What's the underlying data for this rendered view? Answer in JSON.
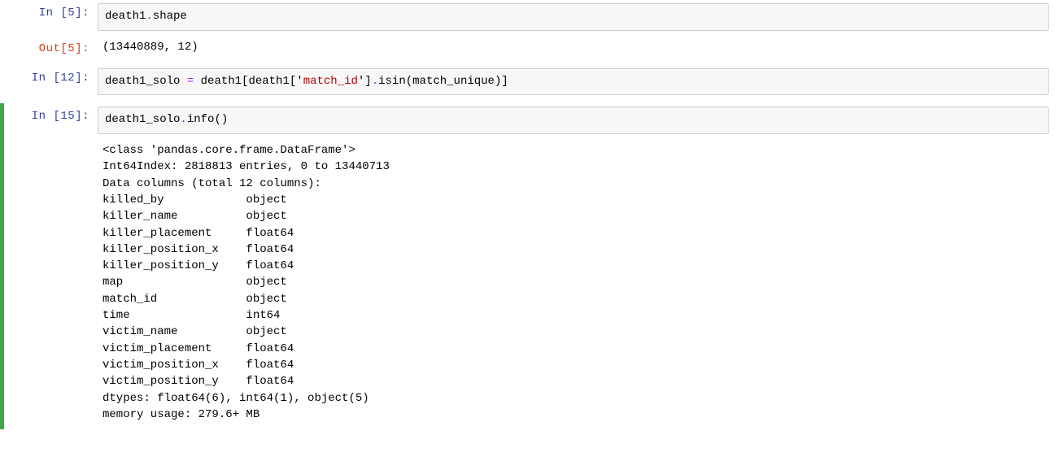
{
  "cells": [
    {
      "execution_count": 5,
      "prompt_in": "In  [5]:",
      "code_tokens": [
        {
          "t": "var",
          "v": "death1"
        },
        {
          "t": "op",
          "v": "."
        },
        {
          "t": "var",
          "v": "shape"
        }
      ],
      "prompt_out": "Out[5]:",
      "output": "(13440889, 12)"
    },
    {
      "execution_count": 12,
      "prompt_in": "In [12]:",
      "code_tokens": [
        {
          "t": "var",
          "v": "death1_solo "
        },
        {
          "t": "op",
          "v": "="
        },
        {
          "t": "var",
          "v": " death1"
        },
        {
          "t": "par",
          "v": "["
        },
        {
          "t": "var",
          "v": "death1"
        },
        {
          "t": "par",
          "v": "['"
        },
        {
          "t": "str",
          "v": "match_id"
        },
        {
          "t": "par",
          "v": "']"
        },
        {
          "t": "op",
          "v": "."
        },
        {
          "t": "fn",
          "v": "isin"
        },
        {
          "t": "par",
          "v": "("
        },
        {
          "t": "var",
          "v": "match_unique"
        },
        {
          "t": "par",
          "v": ")]"
        }
      ]
    },
    {
      "execution_count": 15,
      "selected": true,
      "prompt_in": "In [15]:",
      "code_tokens": [
        {
          "t": "var",
          "v": "death1_solo"
        },
        {
          "t": "op",
          "v": "."
        },
        {
          "t": "fn",
          "v": "info"
        },
        {
          "t": "par",
          "v": "()"
        }
      ],
      "output_lines": [
        "<class 'pandas.core.frame.DataFrame'>",
        "Int64Index: 2818813 entries, 0 to 13440713",
        "Data columns (total 12 columns):",
        "killed_by            object",
        "killer_name          object",
        "killer_placement     float64",
        "killer_position_x    float64",
        "killer_position_y    float64",
        "map                  object",
        "match_id             object",
        "time                 int64",
        "victim_name          object",
        "victim_placement     float64",
        "victim_position_x    float64",
        "victim_position_y    float64",
        "dtypes: float64(6), int64(1), object(5)",
        "memory usage: 279.6+ MB"
      ]
    }
  ]
}
